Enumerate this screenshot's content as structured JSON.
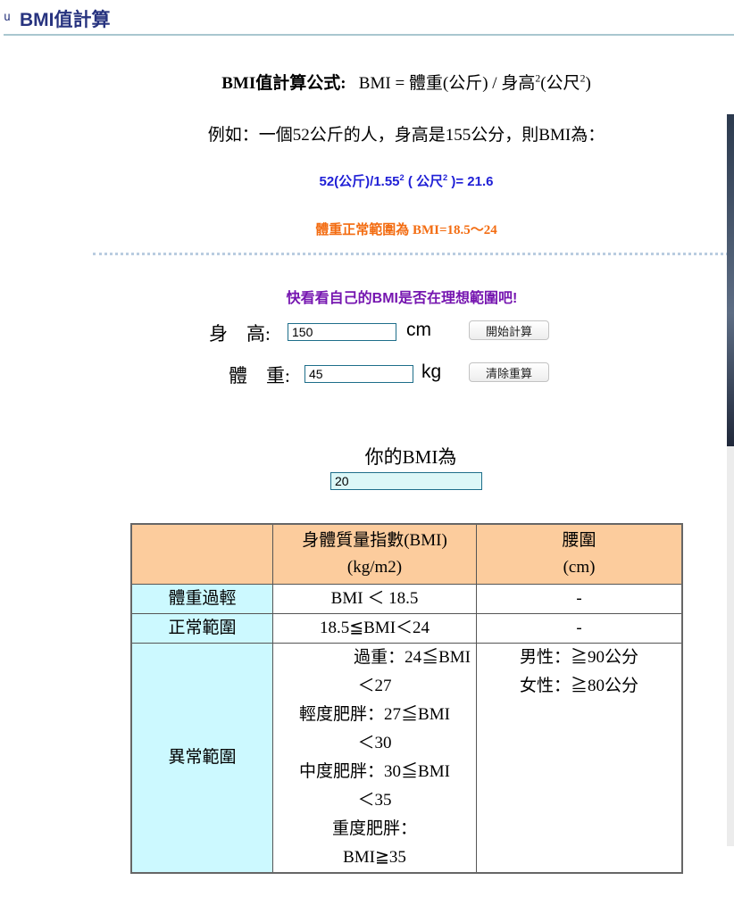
{
  "header": {
    "bullet": "u",
    "title": "BMI值計算"
  },
  "formula": {
    "label": "BMI值計算公式:",
    "text_before_sup": "BMI = 體重(公斤) / 身高",
    "sup1": "2",
    "text_mid": "(公尺",
    "sup2": "2",
    "text_end": ")"
  },
  "example": {
    "text": "例如：一個52公斤的人，身高是155公分，則BMI為："
  },
  "calculation": {
    "part1": "52(公斤)/1.55",
    "sup1": "2",
    "part2": " ( 公尺",
    "sup2": "2",
    "part3": " )= 21.6"
  },
  "normal_range": {
    "text": "體重正常範圍為  BMI=18.5～24"
  },
  "form": {
    "prompt_prefix": "快看看自己的",
    "prompt_bold": "BMI是否在理想範圍吧!",
    "height_label": "身　高:",
    "height_value": "150",
    "height_unit": "cm",
    "weight_label": "體　重:",
    "weight_value": "45",
    "weight_unit": "kg",
    "calc_button": "開始計算",
    "clear_button": "清除重算",
    "result_label": "你的BMI為",
    "result_value": "20"
  },
  "table": {
    "headers": [
      "",
      "身體質量指數(BMI)\n(kg/m2)",
      "腰圍\n(cm)"
    ],
    "header_bmi_l1": "身體質量指數(BMI)",
    "header_bmi_l2": "(kg/m2)",
    "header_waist_l1": "腰圍",
    "header_waist_l2": "(cm)",
    "rows": [
      {
        "category": "體重過輕",
        "bmi": "BMI ＜ 18.5",
        "waist": "-"
      },
      {
        "category": "正常範圍",
        "bmi": "18.5≦BMI＜24",
        "waist": "-"
      },
      {
        "category": "異常範圍",
        "bmi_lines": [
          "過重：24≦BMI",
          "＜27",
          "輕度肥胖：27≦BMI",
          "＜30",
          "中度肥胖：30≦BMI",
          "＜35",
          "重度肥胖：",
          "BMI≧35"
        ],
        "waist_lines": [
          "男性：≧90公分",
          "女性：≧80公分"
        ]
      }
    ]
  },
  "colors": {
    "title": "#27337f",
    "calc_text": "#1f1fd6",
    "normal_text": "#f36c11",
    "prompt_text": "#7616b0",
    "table_header_bg": "#fccc9d",
    "table_rowheader_bg": "#ccf9ff",
    "result_bg": "#dcf7f7"
  }
}
